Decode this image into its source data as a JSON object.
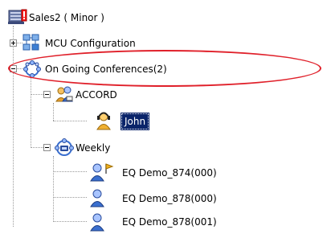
{
  "tree": {
    "root": {
      "label": "Sales2  ( Minor )",
      "icon": "server-alert-icon"
    },
    "mcu_config": {
      "label": "MCU Configuration",
      "icon": "network-config-icon",
      "expander": "+"
    },
    "ongoing": {
      "label": "On Going Conferences(2)",
      "icon": "conferences-globe-icon",
      "expander": "-",
      "highlighted": true,
      "highlight_color": "#e0202a"
    },
    "accord": {
      "label": "ACCORD",
      "icon": "conference-participants-icon",
      "expander": "-"
    },
    "john": {
      "label": "John",
      "icon": "participant-headset-icon",
      "selected": true
    },
    "weekly": {
      "label": "Weekly",
      "icon": "conference-phone-icon",
      "expander": "-"
    },
    "participants": [
      {
        "label": "EQ Demo_874(000)",
        "icon": "participant-chair-icon"
      },
      {
        "label": "EQ Demo_878(000)",
        "icon": "participant-icon"
      },
      {
        "label": "EQ Demo_878(001)",
        "icon": "participant-icon"
      }
    ]
  },
  "colors": {
    "selection_bg": "#0a246a",
    "highlight": "#e0202a",
    "tree_lines": "#9a9a9a"
  }
}
